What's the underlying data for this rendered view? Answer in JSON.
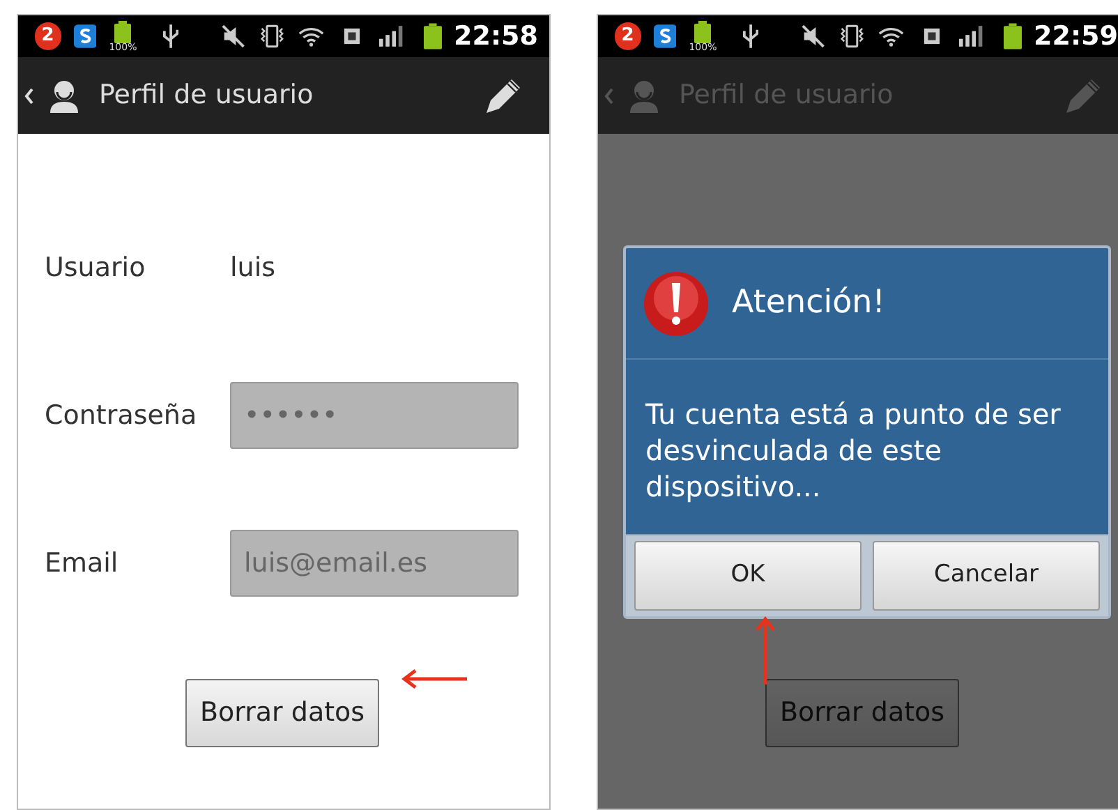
{
  "screens": [
    {
      "status_bar": {
        "badge": "2",
        "battery_label": "100%",
        "time": "22:58"
      },
      "action_bar": {
        "title": "Perfil de usuario"
      },
      "form": {
        "rows": [
          {
            "label": "Usuario",
            "kind": "text",
            "value": "luis"
          },
          {
            "label": "Contraseña",
            "kind": "field",
            "value": "••••••",
            "disabled": true
          },
          {
            "label": "Email",
            "kind": "field",
            "value": "luis@email.es",
            "disabled": true
          }
        ]
      },
      "button": "Borrar datos",
      "dimmed": false
    },
    {
      "status_bar": {
        "badge": "2",
        "battery_label": "100%",
        "time": "22:59"
      },
      "action_bar": {
        "title": "Perfil de usuario"
      },
      "button": "Borrar datos",
      "dimmed": true,
      "dialog": {
        "title": "Atención!",
        "message": "Tu cuenta está a punto de ser desvinculada de este dispositivo...",
        "buttons": [
          "OK",
          "Cancelar"
        ]
      }
    }
  ]
}
